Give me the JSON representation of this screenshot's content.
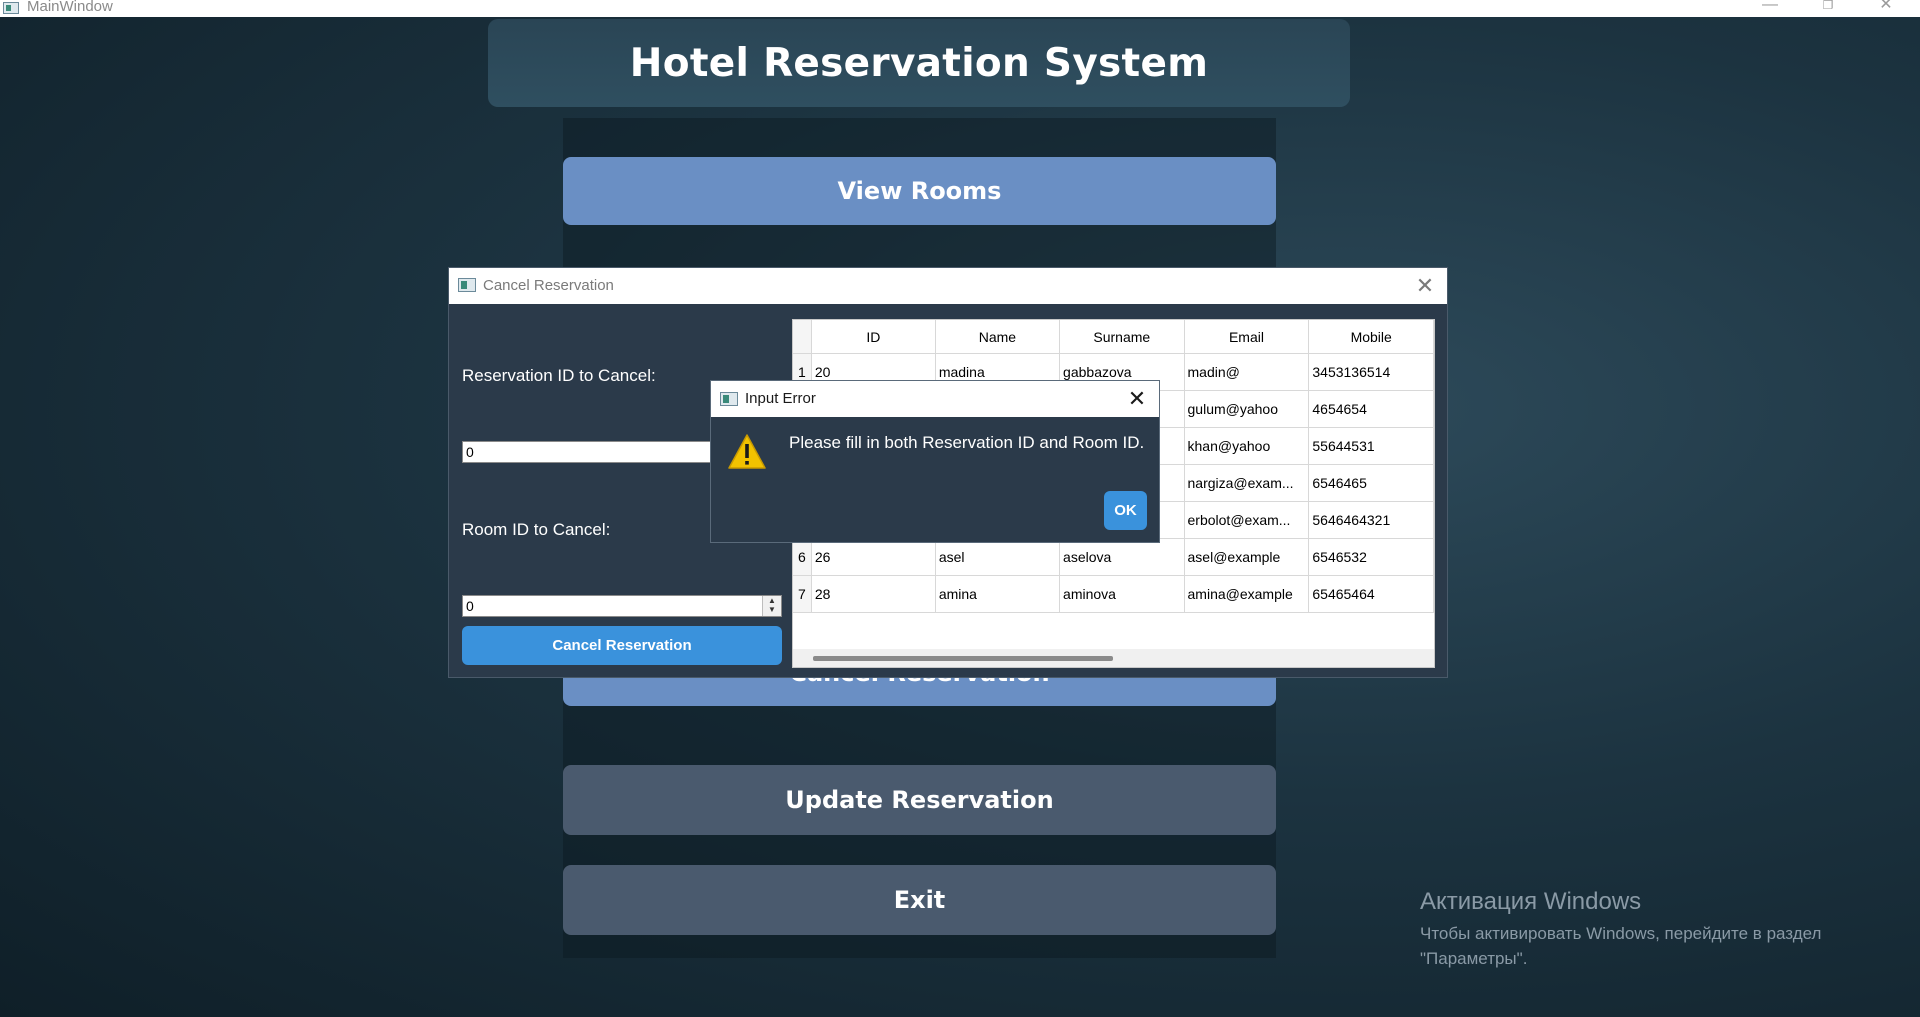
{
  "main_window": {
    "title": "MainWindow",
    "minimize": "—",
    "maximize": "❐",
    "close": "✕"
  },
  "header": {
    "title": "Hotel Reservation System"
  },
  "menu": {
    "view_rooms": "View Rooms",
    "cancel_reservation": "Cancel Reservation",
    "update_reservation": "Update Reservation",
    "exit": "Exit"
  },
  "cancel_dialog": {
    "title": "Cancel Reservation",
    "close": "✕",
    "reservation_id_label": "Reservation ID to Cancel:",
    "reservation_id_value": "0",
    "room_id_label": "Room ID to Cancel:",
    "room_id_value": "0",
    "submit_label": "Cancel Reservation",
    "table": {
      "columns": [
        "ID",
        "Name",
        "Surname",
        "Email",
        "Mobile"
      ],
      "rows": [
        {
          "num": "1",
          "id": "20",
          "name": "madina",
          "surname": "gabbazova",
          "email": "madin@",
          "mobile": "3453136514"
        },
        {
          "num": "2",
          "id": "",
          "name": "",
          "surname": "",
          "email": "gulum@yahoo",
          "mobile": "4654654"
        },
        {
          "num": "3",
          "id": "",
          "name": "",
          "surname": "",
          "email": "khan@yahoo",
          "mobile": "55644531"
        },
        {
          "num": "4",
          "id": "",
          "name": "",
          "surname": "",
          "email": "nargiza@exam...",
          "mobile": "6546465"
        },
        {
          "num": "5",
          "id": "",
          "name": "",
          "surname": "",
          "email": "erbolot@exam...",
          "mobile": "5646464321"
        },
        {
          "num": "6",
          "id": "26",
          "name": "asel",
          "surname": "aselova",
          "email": "asel@example",
          "mobile": "6546532"
        },
        {
          "num": "7",
          "id": "28",
          "name": "amina",
          "surname": "aminova",
          "email": "amina@example",
          "mobile": "65465464"
        }
      ]
    }
  },
  "error_dialog": {
    "title": "Input Error",
    "close": "✕",
    "icon": "warning-icon",
    "message": "Please fill in both Reservation ID and Room ID.",
    "ok_label": "OK"
  },
  "activation": {
    "title": "Активация Windows",
    "line1": "Чтобы активировать Windows, перейдите в раздел",
    "line2": "\"Параметры\"."
  },
  "colors": {
    "accent": "#3a92dc",
    "view_button": "#6a8fc4",
    "secondary_button": "#4a5a6e",
    "dialog_bg": "#2b3a4a"
  }
}
